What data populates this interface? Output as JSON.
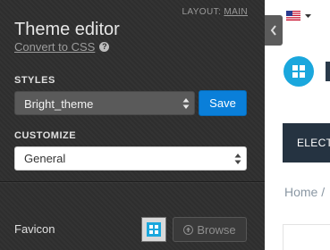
{
  "editor": {
    "layout_label": "LAYOUT:",
    "layout_value": "MAIN",
    "title": "Theme editor",
    "convert_link": "Convert to CSS",
    "styles_label": "STYLES",
    "style_selected": "Bright_theme",
    "save_label": "Save",
    "customize_label": "CUSTOMIZE",
    "customize_selected": "General",
    "favicon_label": "Favicon",
    "browse_label": "Browse"
  },
  "storefront": {
    "nav_label": "ELECTRONICS",
    "breadcrumb": "Home /"
  },
  "colors": {
    "panel_bg": "#2f2f2f",
    "save_blue": "#0a7fd9",
    "logo_blue": "#1aa7dd",
    "nav_dark": "#253341"
  },
  "icons": [
    "help-icon",
    "select-arrows-icon",
    "favicon-icon",
    "browse-icon",
    "chevron-left-icon",
    "us-flag-icon",
    "caret-down-icon",
    "logo-grid-icon"
  ]
}
